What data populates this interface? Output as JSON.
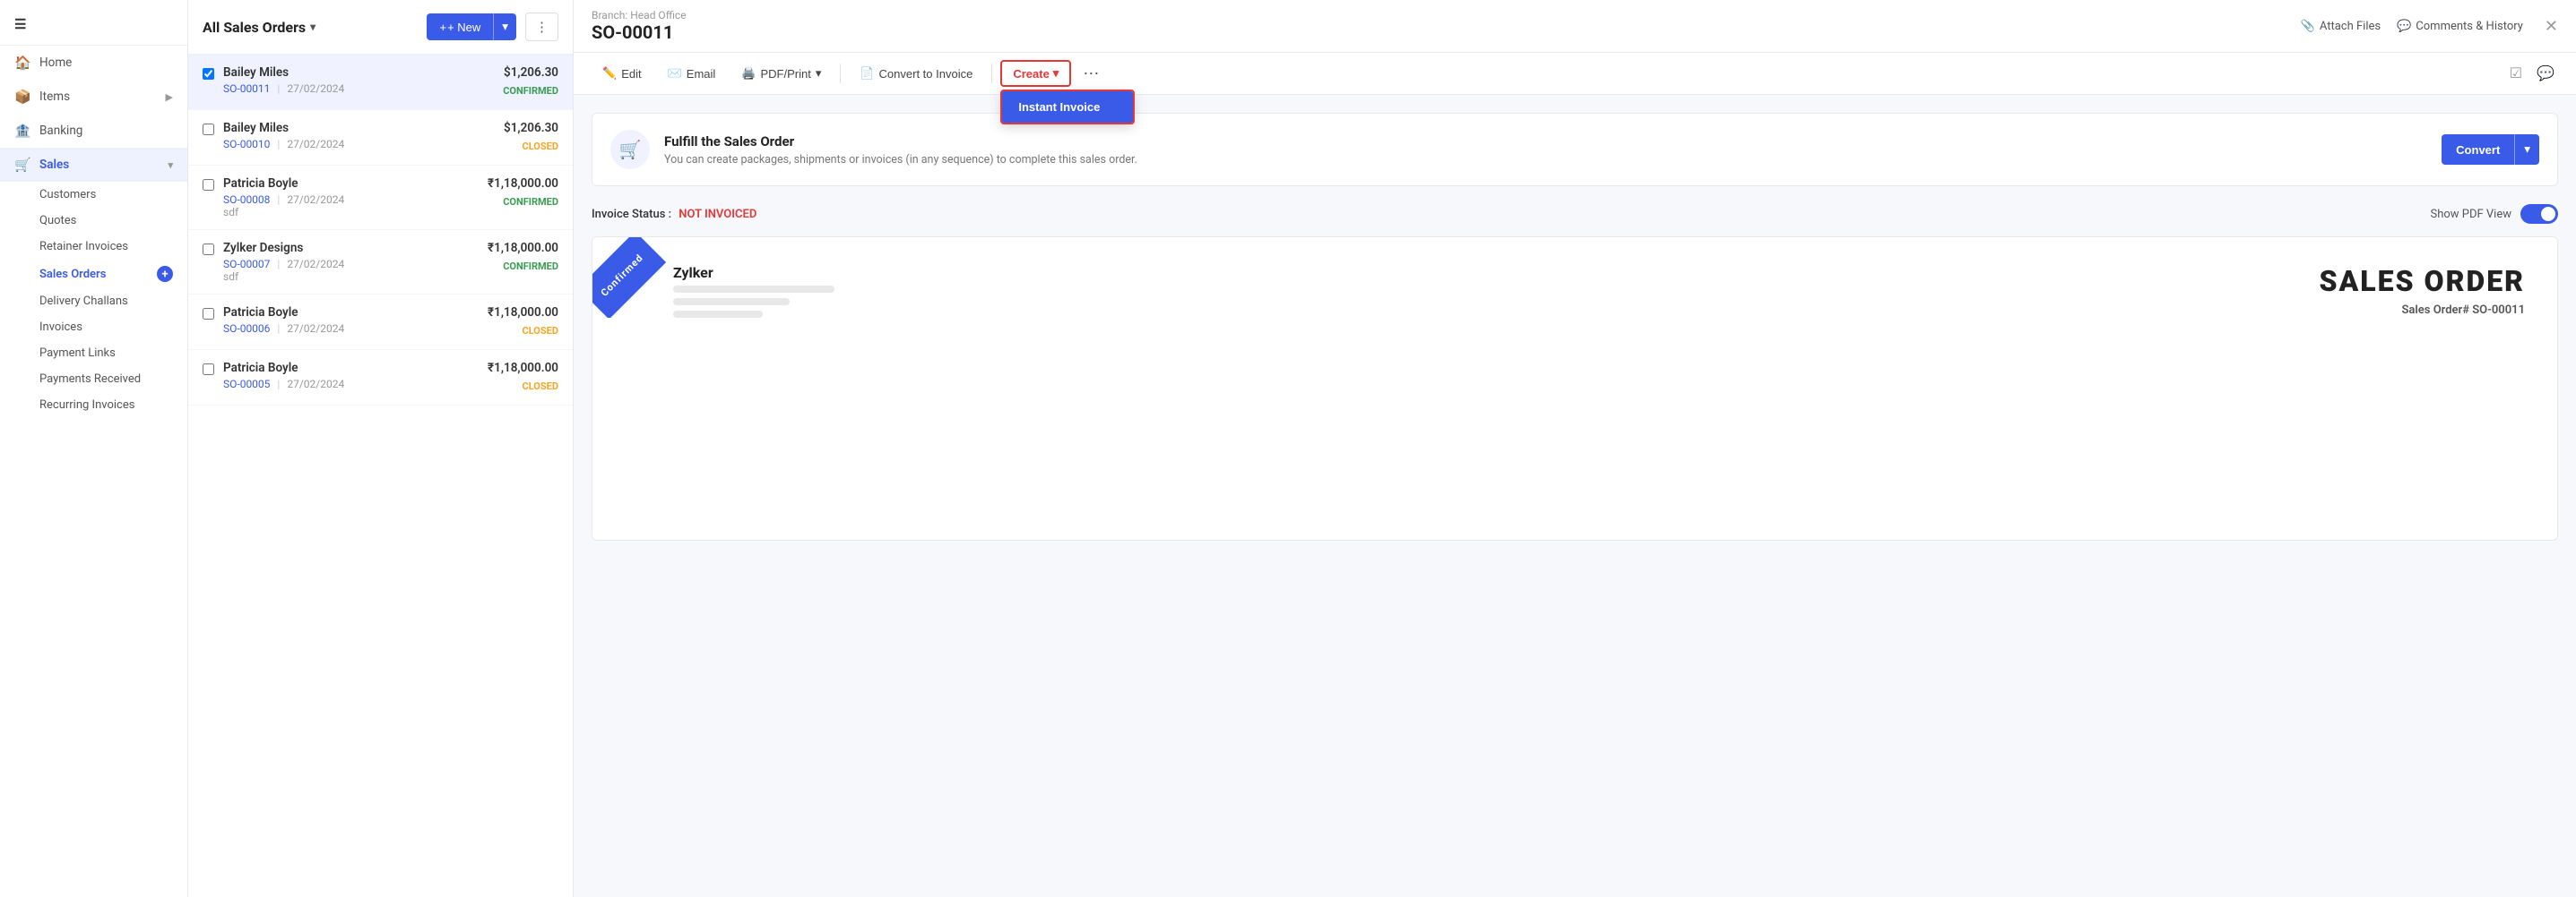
{
  "sidebar": {
    "logo": "☰",
    "items": [
      {
        "id": "home",
        "label": "Home",
        "icon": "🏠",
        "active": false
      },
      {
        "id": "items",
        "label": "Items",
        "icon": "📦",
        "active": false,
        "hasChevron": true
      },
      {
        "id": "banking",
        "label": "Banking",
        "icon": "🏦",
        "active": false
      },
      {
        "id": "sales",
        "label": "Sales",
        "icon": "🛒",
        "active": true,
        "hasChevron": true
      }
    ],
    "sub_items": [
      {
        "id": "customers",
        "label": "Customers",
        "active": false
      },
      {
        "id": "quotes",
        "label": "Quotes",
        "active": false
      },
      {
        "id": "retainer-invoices",
        "label": "Retainer Invoices",
        "active": false
      },
      {
        "id": "sales-orders",
        "label": "Sales Orders",
        "active": true
      },
      {
        "id": "delivery-challans",
        "label": "Delivery Challans",
        "active": false
      },
      {
        "id": "invoices",
        "label": "Invoices",
        "active": false
      },
      {
        "id": "payment-links",
        "label": "Payment Links",
        "active": false
      },
      {
        "id": "payments-received",
        "label": "Payments Received",
        "active": false
      },
      {
        "id": "recurring-invoices",
        "label": "Recurring Invoices",
        "active": false
      }
    ]
  },
  "list": {
    "title": "All Sales Orders",
    "new_label": "+ New",
    "more_dots": "⋮",
    "orders": [
      {
        "id": "1",
        "name": "Bailey Miles",
        "so_number": "SO-00011",
        "date": "27/02/2024",
        "amount": "$1,206.30",
        "status": "CONFIRMED",
        "status_type": "confirmed",
        "sub": "",
        "selected": true
      },
      {
        "id": "2",
        "name": "Bailey Miles",
        "so_number": "SO-00010",
        "date": "27/02/2024",
        "amount": "$1,206.30",
        "status": "CLOSED",
        "status_type": "closed",
        "sub": "",
        "selected": false
      },
      {
        "id": "3",
        "name": "Patricia Boyle",
        "so_number": "SO-00008",
        "date": "27/02/2024",
        "amount": "₹1,18,000.00",
        "status": "CONFIRMED",
        "status_type": "confirmed",
        "sub": "sdf",
        "selected": false
      },
      {
        "id": "4",
        "name": "Zylker Designs",
        "so_number": "SO-00007",
        "date": "27/02/2024",
        "amount": "₹1,18,000.00",
        "status": "CONFIRMED",
        "status_type": "confirmed",
        "sub": "sdf",
        "selected": false
      },
      {
        "id": "5",
        "name": "Patricia Boyle",
        "so_number": "SO-00006",
        "date": "27/02/2024",
        "amount": "₹1,18,000.00",
        "status": "CLOSED",
        "status_type": "closed",
        "sub": "",
        "selected": false
      },
      {
        "id": "6",
        "name": "Patricia Boyle",
        "so_number": "SO-00005",
        "date": "27/02/2024",
        "amount": "₹1,18,000.00",
        "status": "CLOSED",
        "status_type": "closed",
        "sub": "",
        "selected": false
      }
    ]
  },
  "detail": {
    "branch": "Branch: Head Office",
    "so_number": "SO-00011",
    "actions": {
      "edit": "Edit",
      "email": "Email",
      "pdf_print": "PDF/Print",
      "convert_to_invoice": "Convert to Invoice",
      "create": "Create",
      "instant_invoice": "Instant Invoice",
      "more_dots": "⋯",
      "attach_files": "Attach Files",
      "comments_history": "Comments & History"
    },
    "fulfill": {
      "title": "Fulfill the Sales Order",
      "desc": "You can create packages, shipments or invoices (in any sequence) to complete this sales order.",
      "convert": "Convert",
      "icon": "🛒"
    },
    "invoice_status_label": "Invoice Status :",
    "invoice_status_value": "NOT INVOICED",
    "show_pdf_view": "Show PDF View",
    "pdf": {
      "ribbon_text": "Confirmed",
      "company_name": "Zylker",
      "so_title": "SALES ORDER",
      "so_ref": "Sales Order# SO-00011"
    }
  },
  "colors": {
    "confirmed": "#3a9c52",
    "closed": "#f5a623",
    "primary": "#3a5be8",
    "red": "#e63636"
  }
}
